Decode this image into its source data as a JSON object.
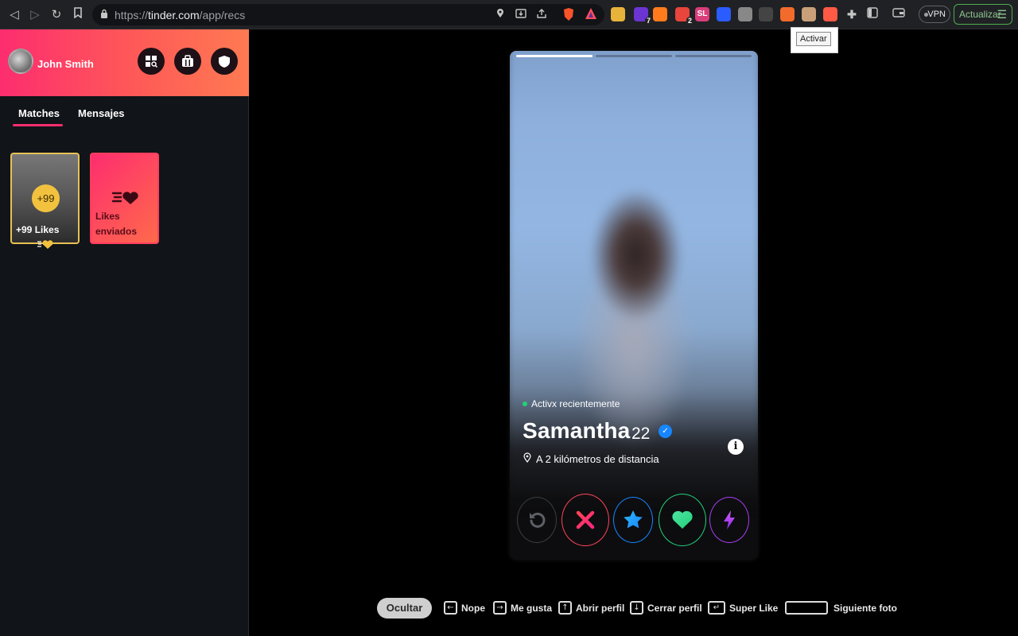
{
  "browser": {
    "url_prefix": "https://",
    "url_host": "tinder.com",
    "url_path": "/app/recs",
    "vpn_label": "VPN",
    "update_label": "Actualizar",
    "tooltip": "Activar",
    "extensions": [
      {
        "name": "puzzle-colors-extension-icon",
        "color": "#e8b33a"
      },
      {
        "name": "purple-extension-icon",
        "color": "#6b35d4",
        "badge": "7"
      },
      {
        "name": "orange-u-extension-icon",
        "color": "#ff7b1c"
      },
      {
        "name": "red-extension-icon",
        "color": "#e8453c",
        "badge": "2"
      },
      {
        "name": "sl-extension-icon",
        "color": "#d93d7a",
        "text": "SL"
      },
      {
        "name": "blue-check-extension-icon",
        "color": "#2b5cff"
      },
      {
        "name": "camera-extension-icon",
        "color": "#888888"
      },
      {
        "name": "glasses-extension-icon",
        "color": "#444444"
      },
      {
        "name": "orange-circle-extension-icon",
        "color": "#f26b2a"
      },
      {
        "name": "owl-extension-icon",
        "color": "#c9a079"
      },
      {
        "name": "tinder-flame-extension-icon",
        "color": "#ff5a45"
      }
    ]
  },
  "sidebar": {
    "user_name": "John Smith",
    "tabs": [
      {
        "label": "Matches"
      },
      {
        "label": "Mensajes"
      }
    ],
    "likes_card": {
      "badge": "+99",
      "label": "+99 Likes"
    },
    "sent_card": {
      "label": "Likes enviados"
    }
  },
  "profile": {
    "status": "Activx recientemente",
    "name": "Samantha",
    "age": "22",
    "distance": "A 2 kilómetros de distancia",
    "photo_count": 3,
    "current_photo": 1
  },
  "hints": {
    "hide_label": "Ocultar",
    "items": [
      {
        "key": "←",
        "label": "Nope"
      },
      {
        "key": "→",
        "label": "Me gusta"
      },
      {
        "key": "↑",
        "label": "Abrir perfil"
      },
      {
        "key": "↓",
        "label": "Cerrar perfil"
      },
      {
        "key": "↵",
        "label": "Super Like"
      },
      {
        "key": "",
        "label": "Siguiente foto"
      }
    ]
  },
  "colors": {
    "brand_pink": "#fd2d6f",
    "brand_orange": "#ff7a52",
    "nope": "#ff4458",
    "super": "#1786ff",
    "like": "#21d07a",
    "boost": "#a93df3",
    "likes_gold": "#f2c23f"
  }
}
